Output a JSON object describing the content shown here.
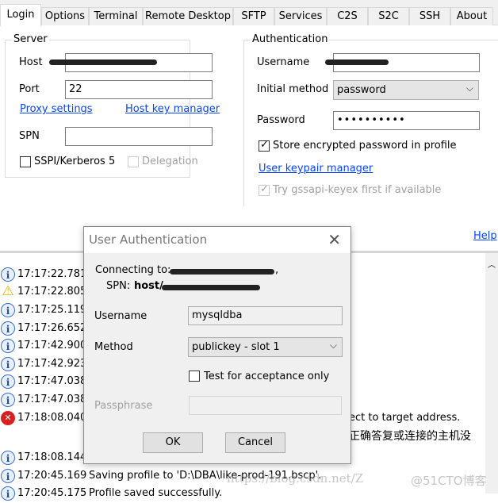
{
  "tabs": [
    {
      "label": "Login",
      "active": true
    },
    {
      "label": "Options"
    },
    {
      "label": "Terminal"
    },
    {
      "label": "Remote Desktop"
    },
    {
      "label": "SFTP"
    },
    {
      "label": "Services"
    },
    {
      "label": "C2S"
    },
    {
      "label": "S2C"
    },
    {
      "label": "SSH"
    },
    {
      "label": "About"
    }
  ],
  "server": {
    "title": "Server",
    "host_label": "Host",
    "port_label": "Port",
    "port_value": "22",
    "proxy_link": "Proxy settings",
    "hostkey_link": "Host key manager",
    "spn_label": "SPN",
    "spn_value": "",
    "sspi_label": "SSPI/Kerberos 5",
    "sspi_checked": false,
    "delegation_label": "Delegation",
    "delegation_checked": false
  },
  "auth": {
    "title": "Authentication",
    "username_label": "Username",
    "method_label": "Initial method",
    "method_value": "password",
    "password_label": "Password",
    "password_value": "••••••••••",
    "store_label": "Store encrypted password in profile",
    "store_checked": true,
    "keypair_link": "User keypair manager",
    "gssapi_label": "Try gssapi-keyex first if available",
    "gssapi_checked": true
  },
  "help_link": "Help",
  "log": [
    {
      "icon": "info",
      "time": "17:17:22.781",
      "msg": ""
    },
    {
      "icon": "warning",
      "time": "17:17:22.805",
      "msg": ""
    },
    {
      "icon": "info",
      "time": "17:17:25.119",
      "msg": ""
    },
    {
      "icon": "info",
      "time": "17:17:26.652",
      "msg": ""
    },
    {
      "icon": "info",
      "time": "17:17:42.900",
      "msg": ""
    },
    {
      "icon": "info",
      "time": "17:17:42.923",
      "msg": ""
    },
    {
      "icon": "info",
      "time": "17:17:47.038",
      "msg": ""
    },
    {
      "icon": "info",
      "time": "17:17:47.038",
      "msg": ""
    },
    {
      "icon": "error",
      "time": "17:18:08.040",
      "msg": "ect to target address.",
      "msg2": "正确答复或连接的主机没"
    },
    {
      "icon": "info",
      "time": "17:18:08.144",
      "msg": ""
    },
    {
      "icon": "info",
      "time": "17:20:45.169",
      "msg": "Saving profile to 'D:\\DBA\\like-prod-191.bscp'."
    },
    {
      "icon": "info",
      "time": "17:20:45.175",
      "msg": "Profile saved successfully."
    }
  ],
  "dialog": {
    "title": "User Authentication",
    "connecting_label": "Connecting to:",
    "spn_label": "SPN:",
    "spn_prefix": "host/",
    "username_label": "Username",
    "username_value": "mysqldba",
    "method_label": "Method",
    "method_value": "publickey - slot 1",
    "test_label": "Test for acceptance only",
    "test_checked": false,
    "passphrase_label": "Passphrase",
    "ok": "OK",
    "cancel": "Cancel"
  },
  "watermark": {
    "url": "https://blog.csdn.net/Z",
    "brand": "@51CTO博客"
  }
}
